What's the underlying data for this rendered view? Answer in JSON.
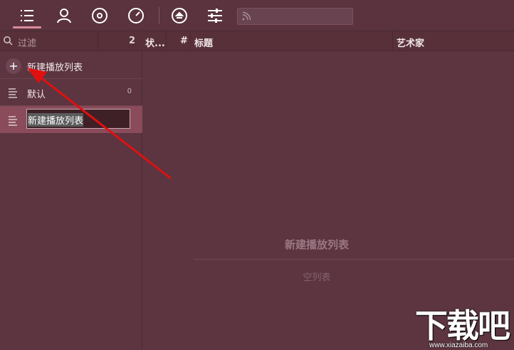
{
  "toolbar": {
    "buttons": [
      {
        "icon": "playlist-icon",
        "active": true
      },
      {
        "icon": "artist-icon"
      },
      {
        "icon": "album-icon"
      },
      {
        "icon": "dial-icon"
      },
      {
        "icon": "eject-icon"
      },
      {
        "icon": "equalizer-icon"
      }
    ],
    "search_placeholder": ""
  },
  "filter": {
    "placeholder": "过滤",
    "count": "2"
  },
  "playlists": [
    {
      "label": "新建播放列表",
      "icon": "plus-icon",
      "kind": "add"
    },
    {
      "label": "默认",
      "count": "0",
      "icon": "list-icon"
    },
    {
      "label": "新建播放列表",
      "icon": "list-icon",
      "editing": true
    }
  ],
  "columns": {
    "status": "状...",
    "number": "#",
    "title": "标题",
    "artist": "艺术家"
  },
  "empty": {
    "title": "新建播放列表",
    "subtitle": "空列表"
  },
  "watermark": {
    "text": "下载吧",
    "url": "www.xiazaiba.com"
  },
  "colors": {
    "background": "#5c3540",
    "selected": "#8a4b5a",
    "accent": "#d98a9a",
    "arrow": "#e01010"
  }
}
